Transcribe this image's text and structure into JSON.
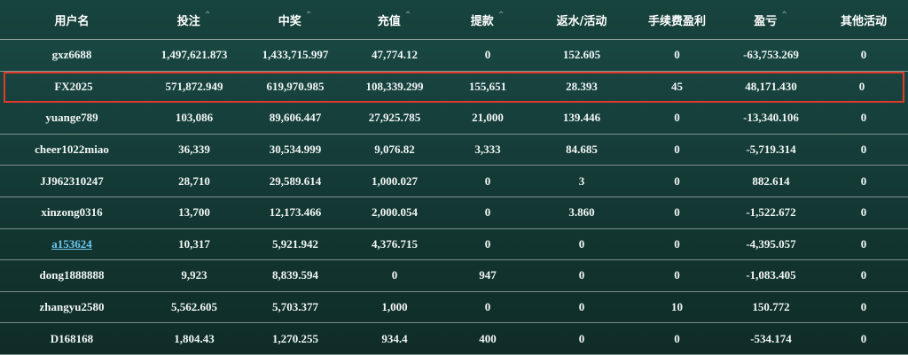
{
  "headers": [
    {
      "label": "用户名",
      "sortable": false
    },
    {
      "label": "投注",
      "sortable": true
    },
    {
      "label": "中奖",
      "sortable": true
    },
    {
      "label": "充值",
      "sortable": true
    },
    {
      "label": "提款",
      "sortable": true
    },
    {
      "label": "返水/活动",
      "sortable": false
    },
    {
      "label": "手续费盈利",
      "sortable": false
    },
    {
      "label": "盈亏",
      "sortable": true
    },
    {
      "label": "其他活动",
      "sortable": false
    }
  ],
  "rows": [
    {
      "user": "gxz6688",
      "cells": [
        "1,497,621.873",
        "1,433,715.997",
        "47,774.12",
        "0",
        "152.605",
        "0",
        "-63,753.269",
        "0"
      ]
    },
    {
      "user": "FX2025",
      "cells": [
        "571,872.949",
        "619,970.985",
        "108,339.299",
        "155,651",
        "28.393",
        "45",
        "48,171.430",
        "0"
      ]
    },
    {
      "user": "yuange789",
      "cells": [
        "103,086",
        "89,606.447",
        "27,925.785",
        "21,000",
        "139.446",
        "0",
        "-13,340.106",
        "0"
      ]
    },
    {
      "user": "cheer1022miao",
      "cells": [
        "36,339",
        "30,534.999",
        "9,076.82",
        "3,333",
        "84.685",
        "0",
        "-5,719.314",
        "0"
      ]
    },
    {
      "user": "JJ962310247",
      "cells": [
        "28,710",
        "29,589.614",
        "1,000.027",
        "0",
        "3",
        "0",
        "882.614",
        "0"
      ]
    },
    {
      "user": "xinzong0316",
      "cells": [
        "13,700",
        "12,173.466",
        "2,000.054",
        "0",
        "3.860",
        "0",
        "-1,522.672",
        "0"
      ]
    },
    {
      "user": "a153624",
      "cells": [
        "10,317",
        "5,921.942",
        "4,376.715",
        "0",
        "0",
        "0",
        "-4,395.057",
        "0"
      ]
    },
    {
      "user": "dong1888888",
      "cells": [
        "9,923",
        "8,839.594",
        "0",
        "947",
        "0",
        "0",
        "-1,083.405",
        "0"
      ]
    },
    {
      "user": "zhangyu2580",
      "cells": [
        "5,562.605",
        "5,703.377",
        "1,000",
        "0",
        "0",
        "10",
        "150.772",
        "0"
      ]
    },
    {
      "user": "D168168",
      "cells": [
        "1,804.43",
        "1,270.255",
        "934.4",
        "400",
        "0",
        "0",
        "-534.174",
        "0"
      ]
    }
  ],
  "colors": {
    "highlight_border": "#e03a2f",
    "link": "#6ec9f0"
  }
}
